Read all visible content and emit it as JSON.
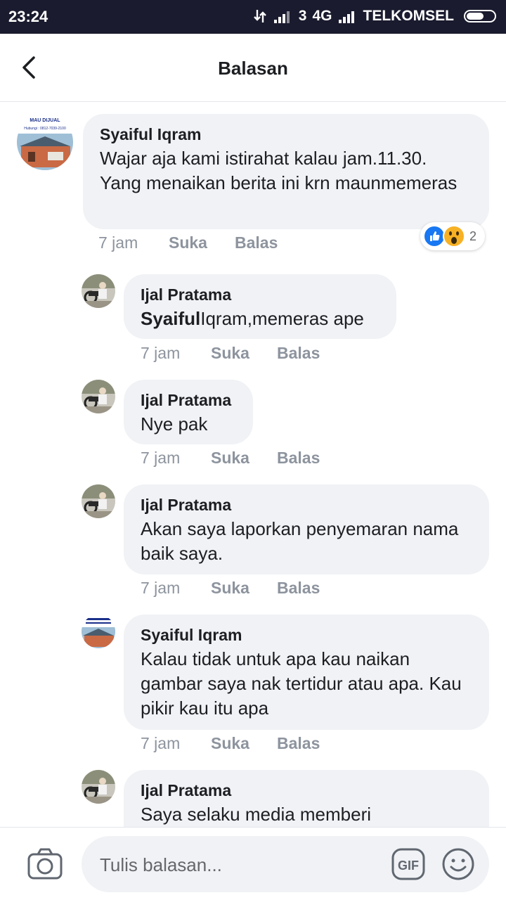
{
  "status_bar": {
    "time": "23:24",
    "network1": "3",
    "network2": "4G",
    "carrier": "TELKOMSEL"
  },
  "header": {
    "title": "Balasan"
  },
  "comments": [
    {
      "author": "Syaiful Iqram",
      "text": "Wajar aja kami istirahat kalau jam.11.30. Yang menaikan berita ini krn maunmemeras",
      "time": "7 jam",
      "like": "Suka",
      "reply": "Balas",
      "avatar_caption_1": "MAU DIJUAL",
      "avatar_caption_2": "Hubungi : 0812-7039-2100",
      "reaction_count": "2"
    },
    {
      "author": "Ijal Pratama",
      "mention": "Syaiful",
      "text": "Iqram,memeras ape",
      "time": "7 jam",
      "like": "Suka",
      "reply": "Balas"
    },
    {
      "author": "Ijal Pratama",
      "text": "Nye pak",
      "time": "7 jam",
      "like": "Suka",
      "reply": "Balas"
    },
    {
      "author": "Ijal Pratama",
      "text": "Akan saya laporkan penyemaran nama baik saya.",
      "time": "7 jam",
      "like": "Suka",
      "reply": "Balas"
    },
    {
      "author": "Syaiful Iqram",
      "text": "Kalau tidak untuk apa kau naikan gambar saya nak tertidur atau apa. Kau pikir kau itu apa",
      "time": "7 jam",
      "like": "Suka",
      "reply": "Balas"
    },
    {
      "author": "Ijal Pratama",
      "text": "Saya selaku media memberi"
    }
  ],
  "composer": {
    "placeholder": "Tulis balasan...",
    "gif_label": "GIF"
  },
  "colors": {
    "bubble": "#f0f2f5",
    "like_blue": "#1877f2",
    "wow_yellow": "#f7b125",
    "meta_gray": "#8d949e"
  }
}
